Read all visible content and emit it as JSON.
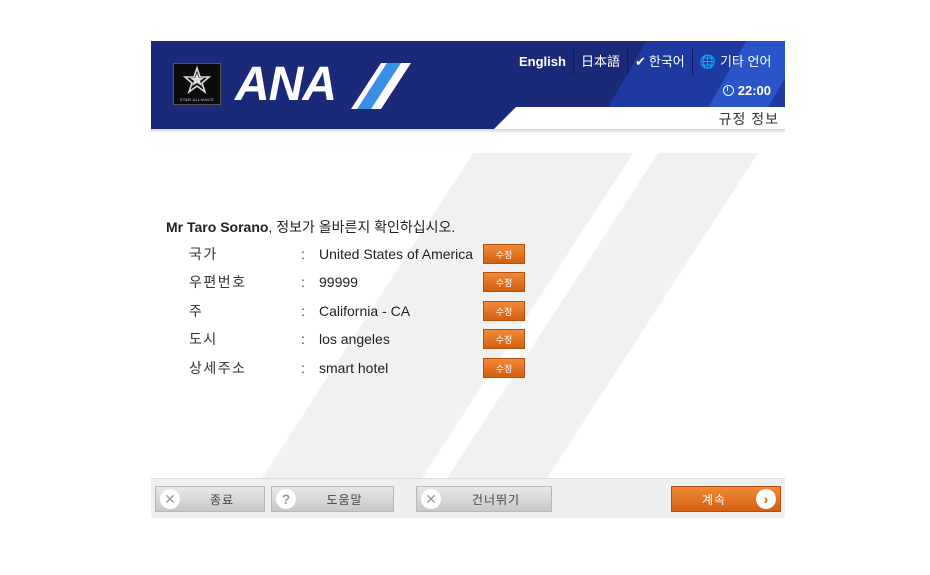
{
  "header": {
    "alliance_text": "STAR ALLIANCE",
    "brand": "ANA",
    "languages": [
      {
        "label": "English"
      },
      {
        "label": "日本語"
      },
      {
        "label": "한국어",
        "selected": true
      },
      {
        "label": "기타 언어"
      }
    ],
    "time": "22:00",
    "page_title": "규정 정보",
    "colors": {
      "navy": "#1b2a78",
      "accent_blue": "#2a55c8",
      "orange": "#e07020"
    }
  },
  "main": {
    "passenger_name": "Mr Taro Sorano",
    "confirm_text": ", 정보가 올바른지 확인하십시오.",
    "fields": [
      {
        "label": "국가",
        "value": "United States of America",
        "edit": "수정"
      },
      {
        "label": "우편번호",
        "value": "99999",
        "edit": "수정"
      },
      {
        "label": "주",
        "value": "California - CA",
        "edit": "수정"
      },
      {
        "label": "도시",
        "value": "los angeles",
        "edit": "수정"
      },
      {
        "label": "상세주소",
        "value": "smart hotel",
        "edit": "수정"
      }
    ]
  },
  "footer": {
    "exit": "종료",
    "help": "도움말",
    "skip": "건너뛰기",
    "continue": "계속"
  }
}
